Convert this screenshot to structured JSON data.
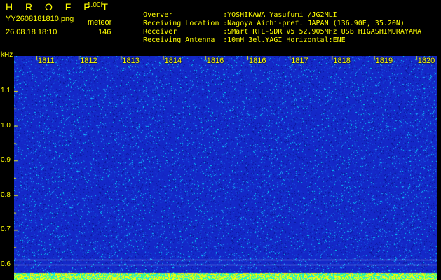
{
  "header": {
    "app_title": "H R O F F T",
    "app_version": "1.00f",
    "file_name": "YY2608181810.png",
    "event_type": "meteor",
    "date_time": "26.08.18 18:10",
    "event_count": "146"
  },
  "station_info": [
    {
      "label": "Overver",
      "value": "YOSHIKAWA Yasufumi /JG2MLI"
    },
    {
      "label": "Receiving Location",
      "value": "Nagoya Aichi-pref. JAPAN (136.90E, 35.20N)"
    },
    {
      "label": "Receiver",
      "value": "SMart RTL-SDR V5 52.905MHz USB HIGASHIMURAYAMA"
    },
    {
      "label": "Receiving Antenna",
      "value": "10mH 3el.YAGI Horizontal:ENE"
    }
  ],
  "chart_data": {
    "type": "heatmap",
    "ylabel": "kHz",
    "y_ticks": [
      "1.1",
      "1.0",
      "0.9",
      "0.8",
      "0.7",
      "0.6"
    ],
    "x_ticks": [
      "1811",
      "1812",
      "1813",
      "1814",
      "1816",
      "1816",
      "1817",
      "1818",
      "1819",
      "1820"
    ],
    "colors": {
      "background": "#1a33c8",
      "speckle_cyan": "#00e0ff",
      "speckle_green": "#40ff80",
      "speckle_yellow": "#ffff00",
      "gridline": "#ffffff",
      "label": "#ffff00"
    }
  }
}
